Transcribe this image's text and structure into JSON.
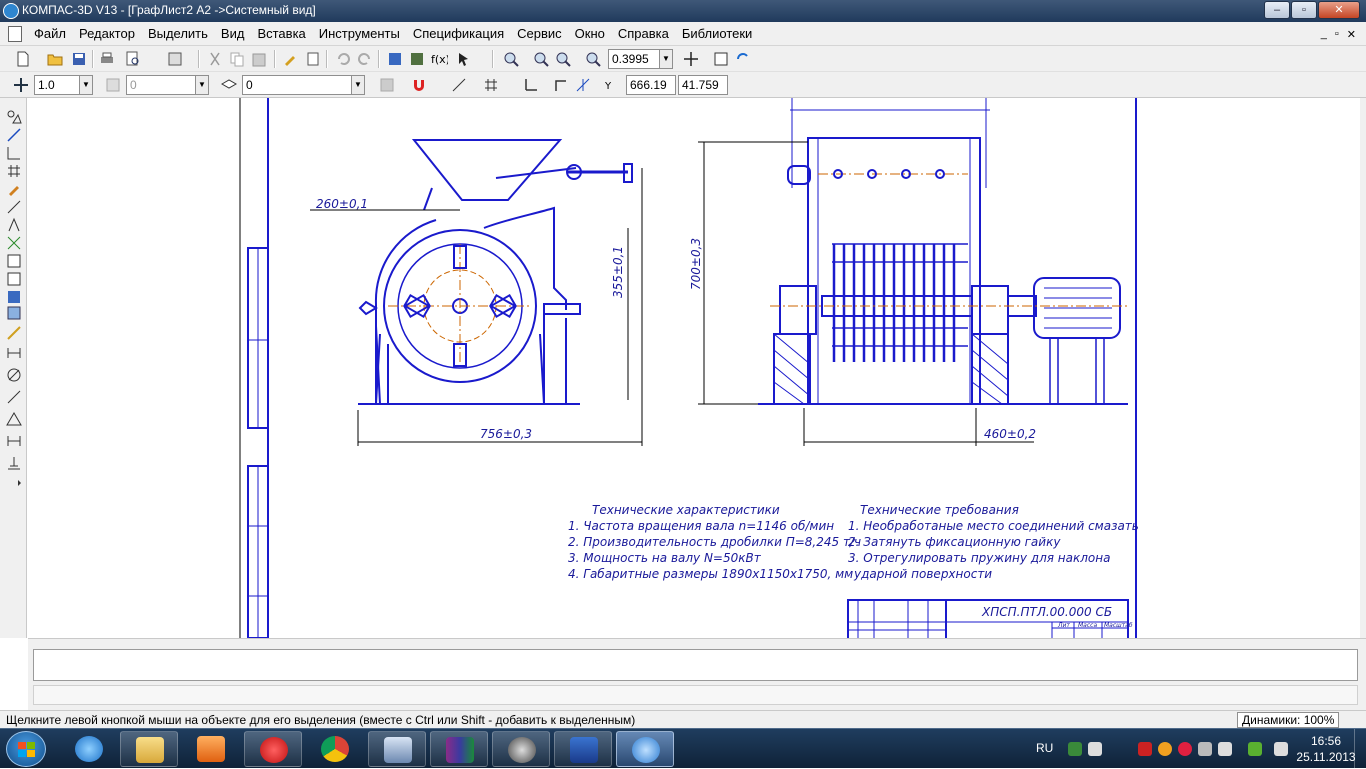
{
  "window": {
    "title": "КОМПАС-3D V13 - [ГрафЛист2 A2 ->Системный вид]",
    "buttons": [
      "–",
      "▫",
      "✕"
    ]
  },
  "menu": {
    "items": [
      "Файл",
      "Редактор",
      "Выделить",
      "Вид",
      "Вставка",
      "Инструменты",
      "Спецификация",
      "Сервис",
      "Окно",
      "Справка",
      "Библиотеки"
    ],
    "mdi_buttons": [
      "_",
      "▫",
      "✕"
    ]
  },
  "toolbar1": {
    "zoom_value": "0.3995"
  },
  "toolbar2": {
    "step_value": "1.0",
    "angle_value": "0",
    "layer_value": "0",
    "coord_x": "666.19",
    "coord_y": "41.759"
  },
  "drawing": {
    "dim_left_top": "260±0,1",
    "dim_left_vertical": "355±0,1",
    "dim_left_bottom": "756±0,3",
    "dim_right_vertical": "700±0,3",
    "dim_right_bottom": "460±0,2",
    "tech_chars_title": "Технические характеристики",
    "tech_chars": [
      "1. Частота вращения вала n=1146 об/мин",
      "2. Производительность дробилки П=8,245 т/ч",
      "3. Мощность на валу N=50кВт",
      "4. Габаритные размеры 1890х1150х1750, мм"
    ],
    "tech_req_title": "Технические требования",
    "tech_req": [
      "1. Необработаные место соединений смазать",
      "2. Затянуть фиксационную гайку",
      "3. Отрегулировать пружину для наклона",
      "ударной поверхности"
    ],
    "stamp_code": "ХПСП.ПТЛ.00.000 СБ",
    "stamp_headers": [
      "Лит",
      "Масса",
      "Масштаб"
    ]
  },
  "status": {
    "message": "Щелкните левой кнопкой мыши на объекте для его выделения (вместе с Ctrl или Shift - добавить к выделенным)",
    "dynamics": "Динамики: 100%"
  },
  "taskbar": {
    "lang": "RU",
    "time": "16:56",
    "date": "25.11.2013"
  },
  "colors": {
    "drawing_line": "#1a1acc",
    "axis_line": "#cc6600",
    "titlebar": "#2a4468"
  }
}
